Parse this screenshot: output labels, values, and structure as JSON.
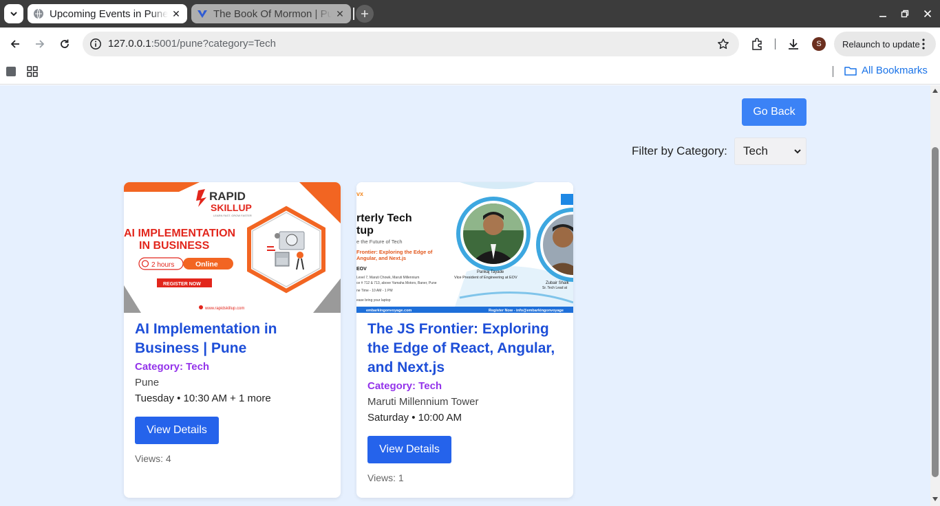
{
  "browser": {
    "tabs": [
      {
        "title": "Upcoming Events in Pune",
        "active": true
      },
      {
        "title": "The Book Of Mormon | Pune",
        "active": false
      }
    ],
    "url_host": "127.0.0.1",
    "url_rest": ":5001/pune?category=Tech",
    "profile_initial": "S",
    "relaunch_label": "Relaunch to update",
    "bookmarks_label": "All Bookmarks"
  },
  "page": {
    "go_back_label": "Go Back",
    "filter_label": "Filter by Category:",
    "filter_value": "Tech",
    "events": [
      {
        "title": "AI Implementation in Business | Pune",
        "category": "Category: Tech",
        "venue": "Pune",
        "when": "Tuesday • 10:30 AM + 1 more",
        "details_label": "View Details",
        "views": "Views: 4",
        "poster": {
          "brand_top": "RAPID",
          "brand_bottom": "SKILLUP",
          "tagline": "LEARN FAST. GROW FASTER",
          "headline_1": "AI IMPLEMENTATION",
          "headline_2": "IN BUSINESS",
          "duration": "2 hours",
          "mode": "Online",
          "cta": "REGISTER NOW",
          "site": "www.rapidskillup.com"
        }
      },
      {
        "title": "The JS Frontier: Exploring the Edge of React, Angular, and Next.js",
        "category": "Category: Tech",
        "venue": "Maruti Millennium Tower",
        "when": "Saturday • 10:00 AM",
        "details_label": "View Details",
        "views": "Views: 1",
        "poster": {
          "brand": "vx",
          "headline_1": "rterly Tech",
          "headline_2": "tup",
          "subtitle": "e the Future of Tech",
          "talk_1": "Frontier: Exploring the Edge of",
          "talk_2": "Angular, and Next.js",
          "org": "EOV",
          "addr_1": "Level 7, Maruti Chowk, Maruti Millennium",
          "addr_2": "ce # 712 & 713, above Yamaha Motors, Baner, Pune",
          "time": "ne Time - 10 AM - 1 PM",
          "note": "ease bring your laptop",
          "speaker_1": "Pankaj Tayade",
          "speaker_1_role": "Vice President of Engineering at EOV",
          "speaker_2": "Zubair Shaik",
          "speaker_2_role": "Sr. Tech Lead at",
          "footer_left": "embarkingonvoyage.com",
          "footer_right": "Register Now - info@embarkingonvoyage"
        }
      }
    ]
  }
}
